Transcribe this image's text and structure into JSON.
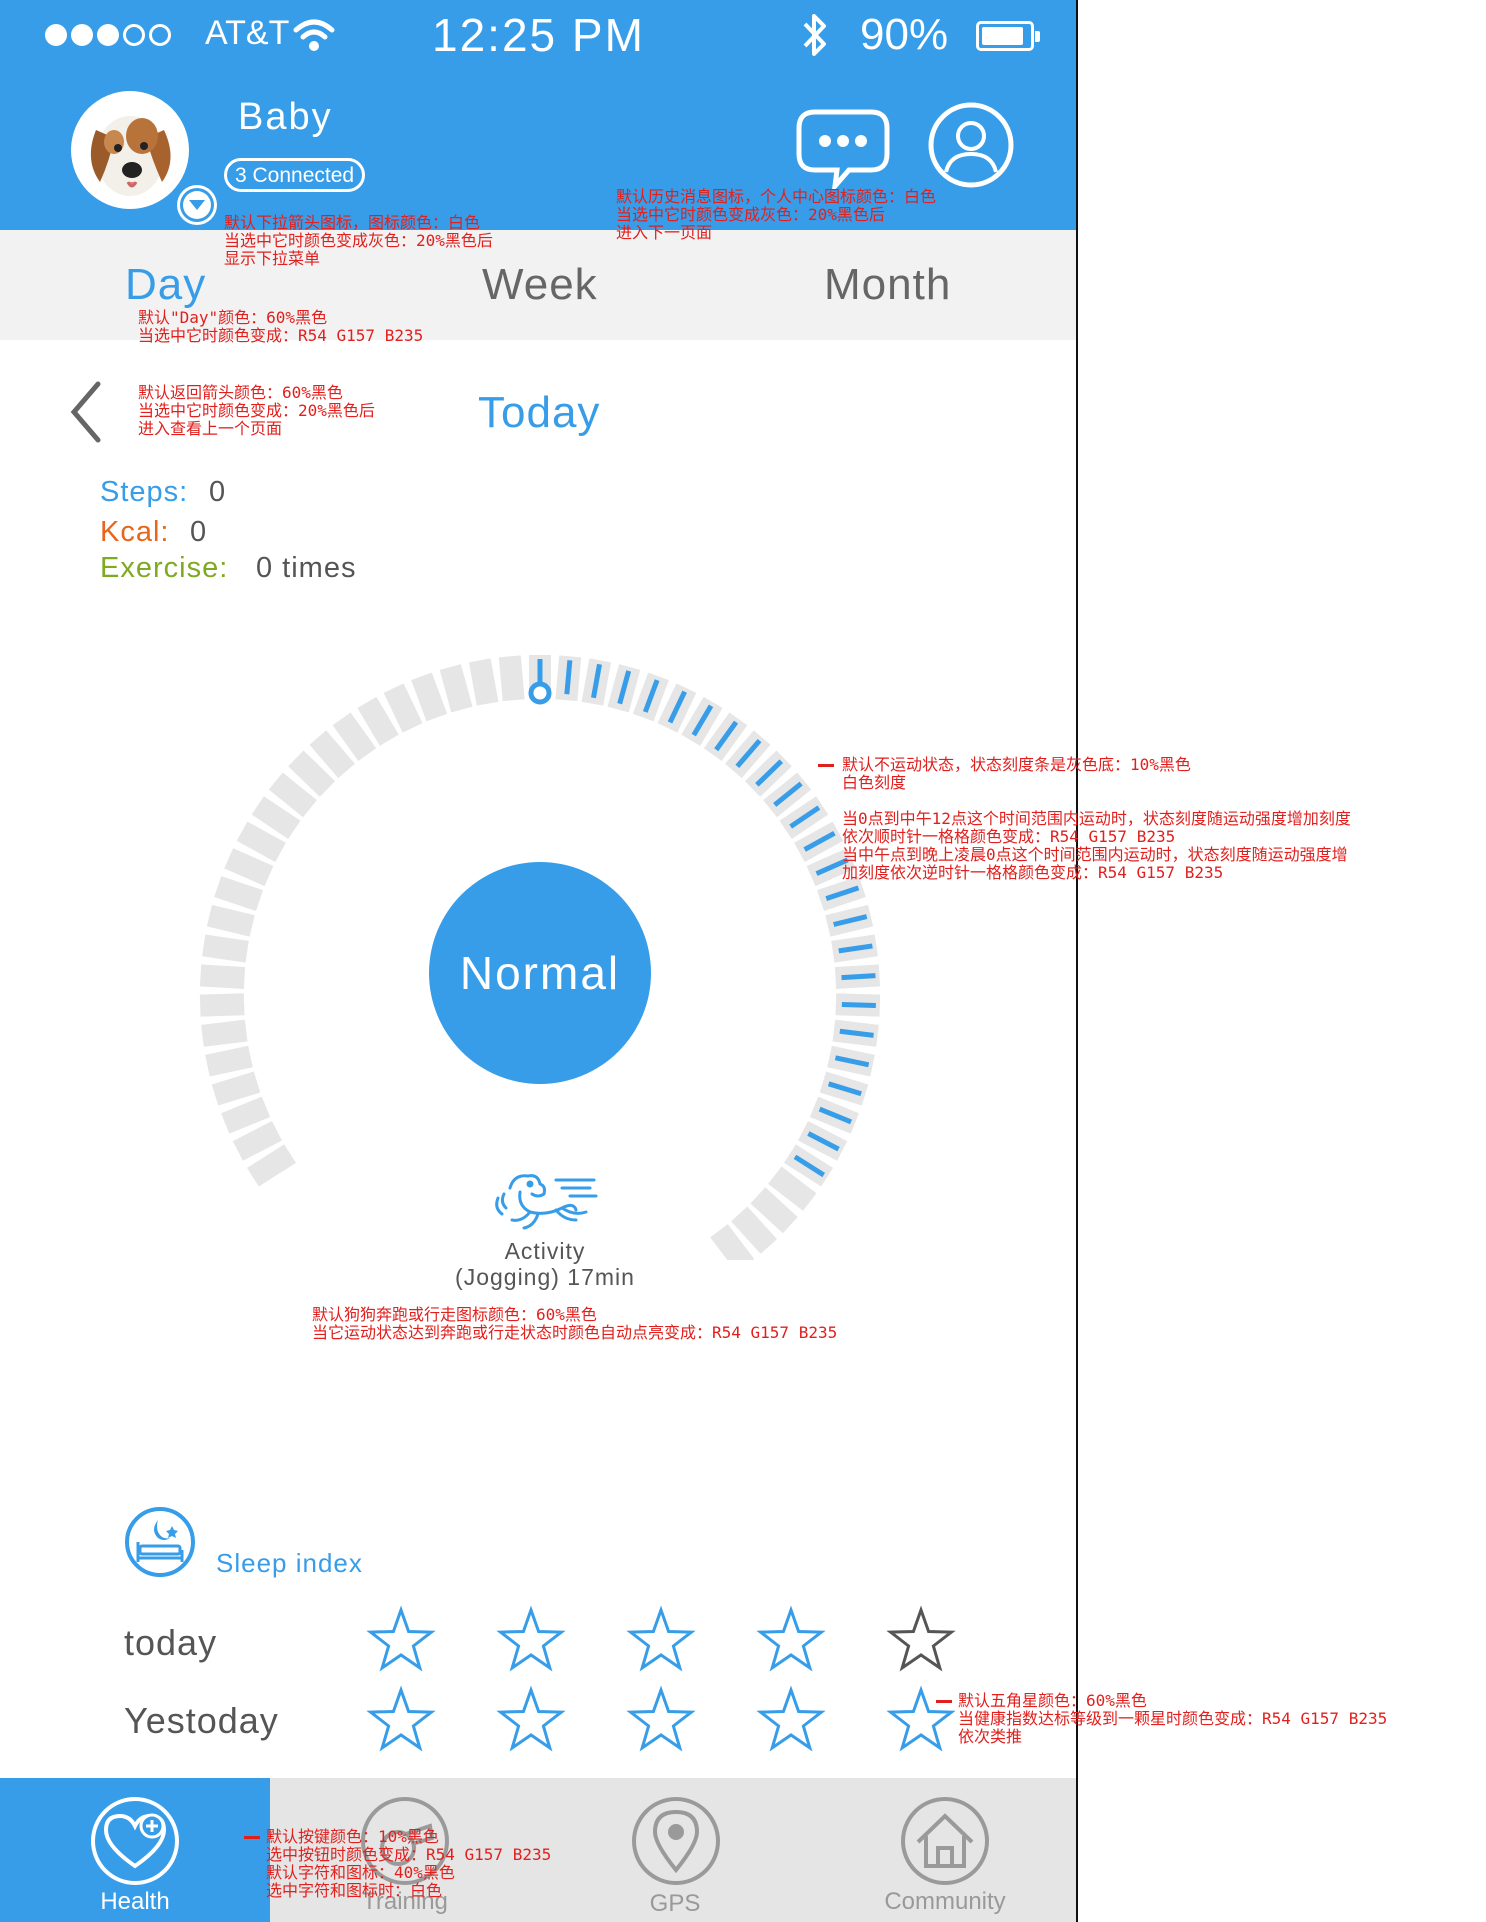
{
  "status_bar": {
    "signal_dots_filled": 3,
    "signal_dots_total": 5,
    "carrier": "AT&T",
    "time": "12:25 PM",
    "battery": "90%",
    "battery_level": 0.9
  },
  "header": {
    "pet_name": "Baby",
    "connected_badge": "3 Connected"
  },
  "tabs": {
    "day": "Day",
    "week": "Week",
    "month": "Month",
    "selected": "Day"
  },
  "period": {
    "title": "Today"
  },
  "stats": {
    "steps_label": "Steps:",
    "steps_value": "0",
    "kcal_label": "Kcal:",
    "kcal_value": "0",
    "exercise_label": "Exercise:",
    "exercise_value": "0 times"
  },
  "gauge": {
    "status": "Normal",
    "activity_label": "Activity",
    "activity_detail": "(Jogging) 17min",
    "total_ticks": 60,
    "active_ticks_clockwise": 25
  },
  "sleep": {
    "title": "Sleep index",
    "rows": [
      {
        "label": "today",
        "stars_active": 4,
        "stars_total": 5
      },
      {
        "label": "Yestoday",
        "stars_active": 5,
        "stars_total": 5
      }
    ]
  },
  "bottom_nav": {
    "items": [
      {
        "label": "Health",
        "icon": "heart-plus-icon",
        "selected": true
      },
      {
        "label": "Training",
        "icon": "whistle-icon",
        "selected": false
      },
      {
        "label": "GPS",
        "icon": "location-pin-icon",
        "selected": false
      },
      {
        "label": "Community",
        "icon": "house-icon",
        "selected": false
      }
    ]
  },
  "colors": {
    "accent": "#379de9",
    "header_bg": "#379de9",
    "kcal": "#e8661b",
    "exercise": "#7faa20",
    "tick_inactive": "#e6e6e6",
    "annotation": "#e1201e"
  },
  "annotations": {
    "dropdown": "默认下拉箭头图标，图标颜色：白色\n当选中它时颜色变成灰色：20%黑色后\n显示下拉菜单",
    "header_icons": "默认历史消息图标，个人中心图标颜色：白色\n当选中它时颜色变成灰色：20%黑色后\n进入下一页面",
    "day_tab": "默认\"Day\"颜色：60%黑色\n当选中它时颜色变成：R54 G157 B235",
    "back_arrow": "默认返回箭头颜色：60%黑色\n当选中它时颜色变成：20%黑色后\n进入查看上一个页面",
    "ticks": "默认不运动状态，状态刻度条是灰色底：10%黑色\n白色刻度\n\n当0点到中午12点这个时间范围内运动时，状态刻度随运动强度增加刻度\n依次顺时针一格格颜色变成：R54 G157 B235\n当中午点到晚上凌晨0点这个时间范围内运动时，状态刻度随运动强度增\n加刻度依次逆时针一格格颜色变成：R54 G157 B235",
    "dog_icon": "默认狗狗奔跑或行走图标颜色：60%黑色\n当它运动状态达到奔跑或行走状态时颜色自动点亮变成：R54 G157 B235",
    "stars": "默认五角星颜色：60%黑色\n当健康指数达标等级到一颗星时颜色变成：R54 G157 B235\n依次类推",
    "buttons": "默认按键颜色：10%黑色\n选中按钮时颜色变成：R54 G157 B235\n默认字符和图标：40%黑色\n选中字符和图标时：白色"
  }
}
